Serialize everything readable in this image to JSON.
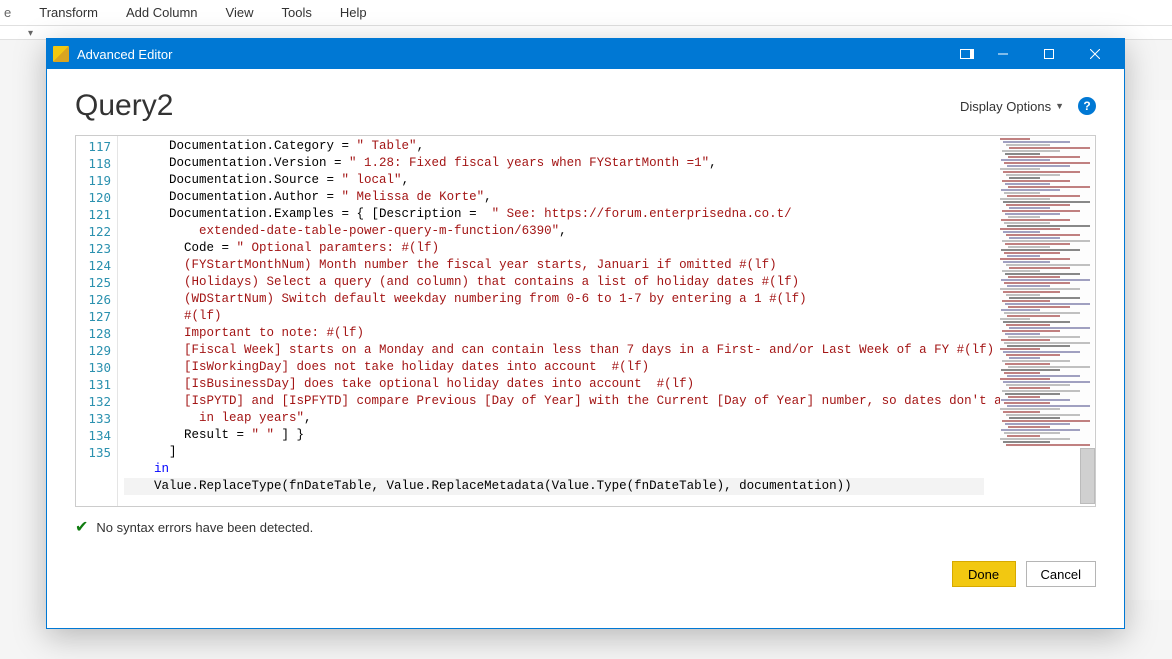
{
  "ribbon": {
    "tabs": [
      "e",
      "Transform",
      "Add Column",
      "View",
      "Tools",
      "Help"
    ]
  },
  "dialog": {
    "title": "Advanced Editor",
    "query_name": "Query2",
    "display_options_label": "Display Options",
    "status": "No syntax errors have been detected.",
    "done_label": "Done",
    "cancel_label": "Cancel"
  },
  "editor": {
    "first_line_no": 117,
    "lines": [
      {
        "n": 117,
        "segs": [
          [
            "pl",
            "      "
          ],
          [
            "id",
            "Documentation.Category = "
          ],
          [
            "str",
            "\" Table\""
          ],
          [
            "pl",
            ","
          ]
        ]
      },
      {
        "n": 118,
        "segs": [
          [
            "pl",
            "      "
          ],
          [
            "id",
            "Documentation.Version = "
          ],
          [
            "str",
            "\" 1.28: Fixed fiscal years when FYStartMonth =1\""
          ],
          [
            "pl",
            ","
          ]
        ]
      },
      {
        "n": 119,
        "segs": [
          [
            "pl",
            "      "
          ],
          [
            "id",
            "Documentation.Source = "
          ],
          [
            "str",
            "\" local\""
          ],
          [
            "pl",
            ","
          ]
        ]
      },
      {
        "n": 120,
        "segs": [
          [
            "pl",
            "      "
          ],
          [
            "id",
            "Documentation.Author = "
          ],
          [
            "str",
            "\" Melissa de Korte\""
          ],
          [
            "pl",
            ","
          ]
        ]
      },
      {
        "n": 121,
        "segs": [
          [
            "pl",
            "      "
          ],
          [
            "id",
            "Documentation.Examples = { [Description =  "
          ],
          [
            "str",
            "\" See: https://forum.enterprisedna.co.t/"
          ]
        ]
      },
      {
        "n": 0,
        "segs": [
          [
            "pl",
            "          "
          ],
          [
            "str",
            "extended-date-table-power-query-m-function/6390\""
          ],
          [
            "pl",
            ","
          ]
        ]
      },
      {
        "n": 122,
        "segs": [
          [
            "pl",
            "        "
          ],
          [
            "id",
            "Code = "
          ],
          [
            "str",
            "\" Optional paramters: #(lf)"
          ]
        ]
      },
      {
        "n": 123,
        "segs": [
          [
            "pl",
            "        "
          ],
          [
            "str",
            "(FYStartMonthNum) Month number the fiscal year starts, Januari if omitted #(lf)"
          ]
        ]
      },
      {
        "n": 124,
        "segs": [
          [
            "pl",
            "        "
          ],
          [
            "str",
            "(Holidays) Select a query (and column) that contains a list of holiday dates #(lf)"
          ]
        ]
      },
      {
        "n": 125,
        "segs": [
          [
            "pl",
            "        "
          ],
          [
            "str",
            "(WDStartNum) Switch default weekday numbering from 0-6 to 1-7 by entering a 1 #(lf)"
          ]
        ]
      },
      {
        "n": 126,
        "segs": [
          [
            "pl",
            "        "
          ],
          [
            "str",
            "#(lf)"
          ]
        ]
      },
      {
        "n": 127,
        "segs": [
          [
            "pl",
            "        "
          ],
          [
            "str",
            "Important to note: #(lf)"
          ]
        ]
      },
      {
        "n": 128,
        "segs": [
          [
            "pl",
            "        "
          ],
          [
            "str",
            "[Fiscal Week] starts on a Monday and can contain less than 7 days in a First- and/or Last Week of a FY #(lf)"
          ]
        ]
      },
      {
        "n": 129,
        "segs": [
          [
            "pl",
            "        "
          ],
          [
            "str",
            "[IsWorkingDay] does not take holiday dates into account  #(lf)"
          ]
        ]
      },
      {
        "n": 130,
        "segs": [
          [
            "pl",
            "        "
          ],
          [
            "str",
            "[IsBusinessDay] does take optional holiday dates into account  #(lf)"
          ]
        ]
      },
      {
        "n": 131,
        "segs": [
          [
            "pl",
            "        "
          ],
          [
            "str",
            "[IsPYTD] and [IsPFYTD] compare Previous [Day of Year] with the Current [Day of Year] number, so dates don't align"
          ]
        ]
      },
      {
        "n": 0,
        "segs": [
          [
            "pl",
            "          "
          ],
          [
            "str",
            "in leap years\""
          ],
          [
            "pl",
            ","
          ]
        ]
      },
      {
        "n": 132,
        "segs": [
          [
            "pl",
            "        "
          ],
          [
            "id",
            "Result = "
          ],
          [
            "str",
            "\" \""
          ],
          [
            "pl",
            " ] }"
          ]
        ]
      },
      {
        "n": 133,
        "segs": [
          [
            "pl",
            "      ]"
          ]
        ]
      },
      {
        "n": 134,
        "segs": [
          [
            "pl",
            "    "
          ],
          [
            "kw",
            "in"
          ]
        ]
      },
      {
        "n": 135,
        "segs": [
          [
            "pl",
            "    "
          ],
          [
            "id",
            "Value.ReplaceType(fnDateTable, Value.ReplaceMetadata(Value.Type(fnDateTable), documentation))"
          ]
        ],
        "current": true
      }
    ]
  }
}
